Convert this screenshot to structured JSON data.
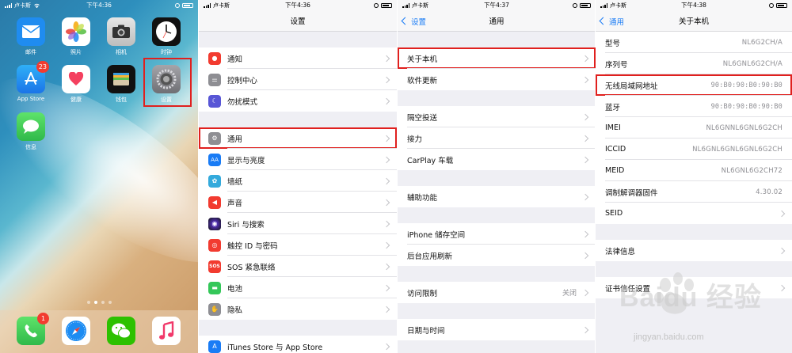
{
  "status": {
    "carrier": "卢卡斯",
    "p1_time": "下午4:36",
    "p2_time": "下午4:36",
    "p3_time": "下午4:37",
    "p4_time": "下午4:38"
  },
  "home": {
    "apps": [
      {
        "label": "邮件",
        "color": "#1f8cf0",
        "icon": "mail-icon"
      },
      {
        "label": "照片",
        "color": "#ffffff",
        "icon": "photos-icon"
      },
      {
        "label": "相机",
        "color": "#d8d8d8",
        "icon": "camera-icon"
      },
      {
        "label": "时钟",
        "color": "#111111",
        "icon": "clock-icon"
      },
      {
        "label": "App Store",
        "color": "#1b8ff2",
        "icon": "appstore-icon",
        "badge": "23"
      },
      {
        "label": "健康",
        "color": "#ffffff",
        "icon": "health-icon"
      },
      {
        "label": "钱包",
        "color": "#111111",
        "icon": "wallet-icon"
      },
      {
        "label": "设置",
        "color": "#8e8e93",
        "icon": "settings-gear-icon"
      },
      {
        "label": "信息",
        "color": "#34c759",
        "icon": "messages-icon"
      }
    ],
    "dock": [
      {
        "label": "电话",
        "color": "#34c759",
        "icon": "phone-icon",
        "badge": "1"
      },
      {
        "label": "Safari",
        "color": "#ffffff",
        "icon": "safari-icon"
      },
      {
        "label": "微信",
        "color": "#2dc100",
        "icon": "wechat-icon"
      },
      {
        "label": "音乐",
        "color": "#ffffff",
        "icon": "music-icon"
      }
    ]
  },
  "settings": {
    "title": "设置",
    "items": [
      {
        "label": "通知",
        "color": "#f23b30"
      },
      {
        "label": "控制中心",
        "color": "#8e8e93"
      },
      {
        "label": "勿扰模式",
        "color": "#5856d6"
      },
      {
        "label": "通用",
        "color": "#8e8e93"
      },
      {
        "label": "显示与亮度",
        "color": "#1a7cf5"
      },
      {
        "label": "墙纸",
        "color": "#34aadc"
      },
      {
        "label": "声音",
        "color": "#f23b30"
      },
      {
        "label": "Siri 与搜索",
        "color": "#222222"
      },
      {
        "label": "触控 ID 与密码",
        "color": "#f23b30"
      },
      {
        "label": "SOS 紧急联络",
        "color": "#f23b30",
        "icon_text": "SOS"
      },
      {
        "label": "电池",
        "color": "#34c759"
      },
      {
        "label": "隐私",
        "color": "#8e8e93"
      },
      {
        "label": "iTunes Store 与 App Store",
        "color": "#1a7cf5"
      }
    ]
  },
  "general": {
    "back": "设置",
    "title": "通用",
    "items": [
      "关于本机",
      "软件更新",
      "隔空投送",
      "接力",
      "CarPlay 车载",
      "辅助功能",
      "iPhone 储存空间",
      "后台应用刷新",
      "访问限制",
      "日期与时间"
    ],
    "restrictions_value": "关闭"
  },
  "about": {
    "back": "通用",
    "title": "关于本机",
    "rows": [
      {
        "k": "型号",
        "v": "NL6G2CH/A"
      },
      {
        "k": "序列号",
        "v": "NL6GNL6G2CH/A"
      },
      {
        "k": "无线局域网地址",
        "v": "90:B0:90:B0:90:B0"
      },
      {
        "k": "蓝牙",
        "v": "90:B0:90:B0:90:B0"
      },
      {
        "k": "IMEI",
        "v": "NL6GNNL6GNL6G2CH"
      },
      {
        "k": "ICCID",
        "v": "NL6GNL6GNL6GNL6G2CH"
      },
      {
        "k": "MEID",
        "v": "NL6GNL6G2CH72"
      },
      {
        "k": "调制解调器固件",
        "v": "4.30.02"
      },
      {
        "k": "SEID",
        "v": ""
      },
      {
        "k": "法律信息",
        "v": ""
      },
      {
        "k": "证书信任设置",
        "v": ""
      }
    ]
  },
  "watermark": {
    "brand": "Baidu 经验",
    "url": "jingyan.baidu.com"
  }
}
